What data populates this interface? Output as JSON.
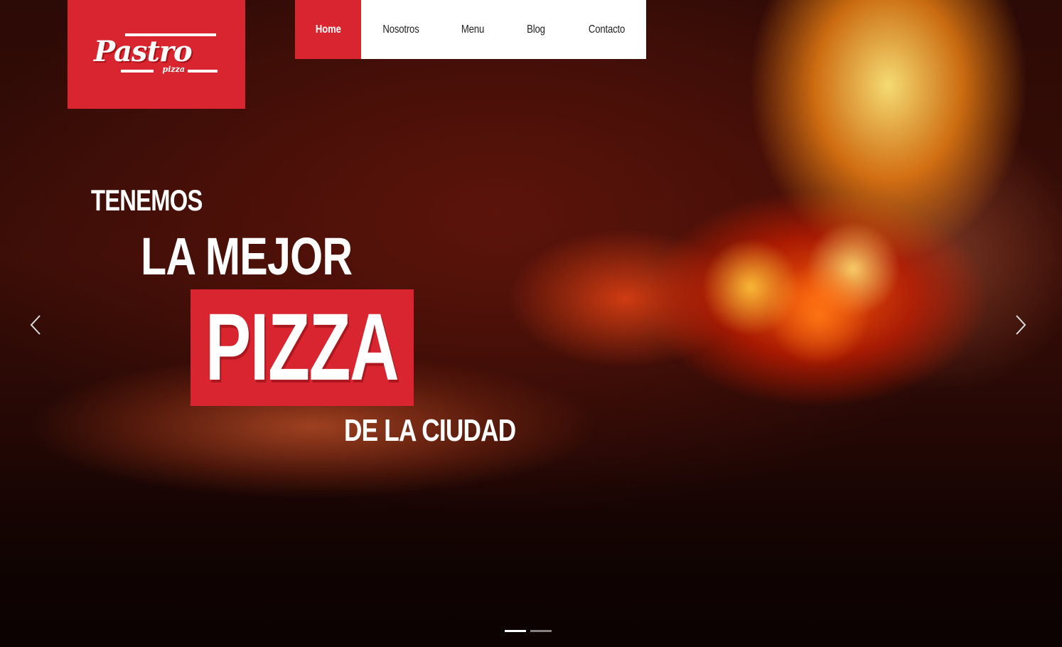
{
  "brand": {
    "name": "Pastro",
    "tagline": "pizza",
    "accent_color": "#d9252f"
  },
  "nav": {
    "items": [
      {
        "label": "Home",
        "active": true
      },
      {
        "label": "Nosotros",
        "active": false
      },
      {
        "label": "Menu",
        "active": false
      },
      {
        "label": "Blog",
        "active": false
      },
      {
        "label": "Contacto",
        "active": false
      }
    ]
  },
  "hero": {
    "line1": "TENEMOS",
    "line2": "LA MEJOR",
    "line3": "PIZZA",
    "line4": "DE LA CIUDAD",
    "prev_icon": "chevron-left-icon",
    "next_icon": "chevron-right-icon"
  },
  "carousel": {
    "slide_count": 2,
    "active_index": 0
  }
}
